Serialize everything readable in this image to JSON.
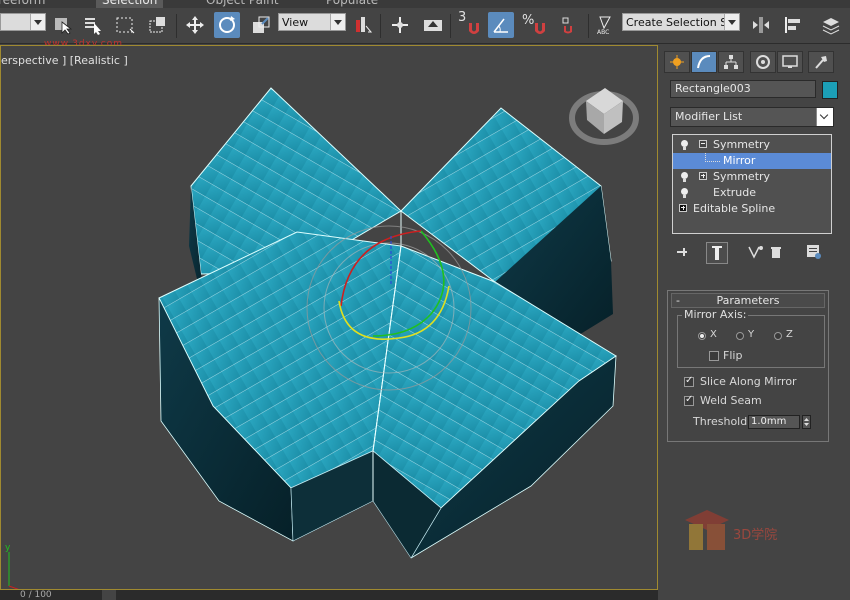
{
  "ribbon": {
    "tabs": [
      "reeform",
      "Selection",
      "Object Paint",
      "Populate"
    ]
  },
  "toolbar": {
    "view_dropdown": "View",
    "selection_set_dropdown": "Create Selection Set",
    "snap_3": "3",
    "percent_snap": "%"
  },
  "watermark_url": "www.3dxy.com",
  "viewport": {
    "label": "erspective ] [Realistic ]"
  },
  "timeline": {
    "frame_counter": "0 / 100"
  },
  "command_panel": {
    "object_name": "Rectangle003",
    "object_color": "#1c9fb7",
    "modifier_list_label": "Modifier List",
    "stack": [
      {
        "label": "Symmetry",
        "expander": "minus",
        "bulb": true,
        "selected": false
      },
      {
        "label": "Mirror",
        "sub": true,
        "selected": true
      },
      {
        "label": "Symmetry",
        "expander": "plus",
        "bulb": true,
        "selected": false
      },
      {
        "label": "Extrude",
        "bulb": true,
        "selected": false
      },
      {
        "label": "Editable Spline",
        "expander": "plus",
        "bulb": false,
        "selected": false
      }
    ],
    "parameters": {
      "title": "Parameters",
      "collapse_symbol": "-",
      "mirror_axis_title": "Mirror Axis:",
      "axes": [
        "X",
        "Y",
        "Z"
      ],
      "selected_axis": "X",
      "flip_label": "Flip",
      "flip_checked": false,
      "slice_label": "Slice Along Mirror",
      "slice_checked": true,
      "weld_label": "Weld Seam",
      "weld_checked": true,
      "threshold_label": "Threshold:",
      "threshold_value": "1.0mm"
    }
  },
  "logo_text": "3D学院",
  "colors": {
    "accent_blue": "#5b8bbd",
    "selection_highlight": "#5b8bd6",
    "model_teal": "#1c9fb7",
    "viewport_border": "#a08a30"
  }
}
